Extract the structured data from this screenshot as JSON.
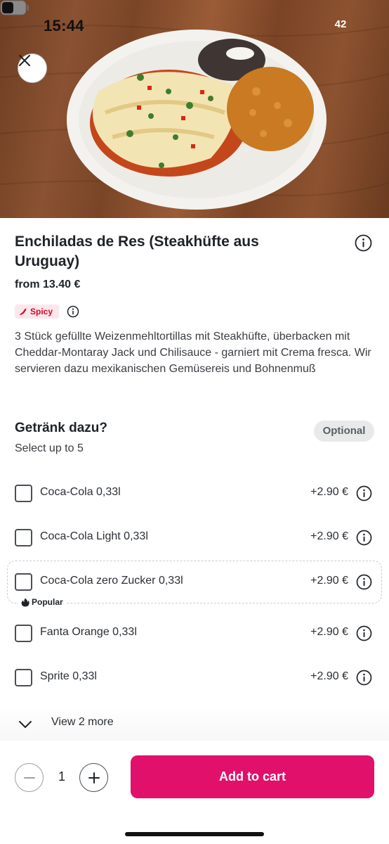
{
  "status_bar": {
    "time": "15:44",
    "battery": "42"
  },
  "product": {
    "title": "Enchiladas de Res (Steakhüfte aus Uruguay)",
    "price": "from 13.40 €",
    "badge": "Spicy",
    "description": "3 Stück gefüllte Weizenmehltortillas mit Steakhüfte, überbacken mit Cheddar-Montaray Jack und Chilisauce - garniert mit Crema fresca. Wir servieren dazu mexikanischen Gemüsereis und Bohnenmuß"
  },
  "options_section": {
    "title": "Getränk dazu?",
    "subtitle": "Select up to 5",
    "badge": "Optional",
    "items": [
      {
        "name": "Coca-Cola 0,33l",
        "price": "+2.90 €",
        "checked": false
      },
      {
        "name": "Coca-Cola Light 0,33l",
        "price": "+2.90 €",
        "checked": false
      },
      {
        "name": "Coca-Cola zero Zucker 0,33l",
        "price": "+2.90 €",
        "checked": false,
        "tag": "Popular"
      },
      {
        "name": "Fanta Orange 0,33l",
        "price": "+2.90 €",
        "checked": false
      },
      {
        "name": "Sprite 0,33l",
        "price": "+2.90 €",
        "checked": false
      }
    ],
    "view_more": "View 2 more"
  },
  "bottom_bar": {
    "quantity": "1",
    "add_to_cart": "Add to cart"
  },
  "colors": {
    "brand": "#e1106a",
    "spicy": "#d3062c",
    "spicy_bg": "#fde7ea"
  },
  "icons": [
    "close-icon",
    "info-icon",
    "chili-icon",
    "flame-icon",
    "chevron-down-icon",
    "minus-icon",
    "plus-icon"
  ]
}
